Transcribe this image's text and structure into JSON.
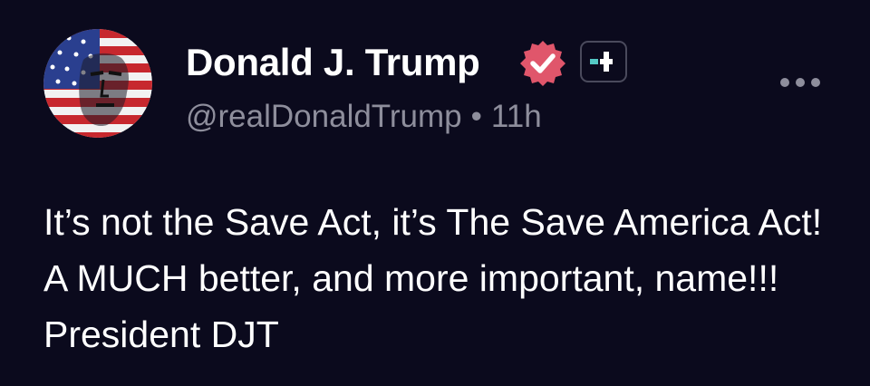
{
  "author": {
    "display_name": "Donald J. Trump",
    "handle": "@realDonaldTrump",
    "separator": "•",
    "timestamp": "11h",
    "verified_badge_icon": "verified-check-icon",
    "verified_badge_color": "#e0566b",
    "subscription_badge_icon": "plus-icon",
    "avatar_icon": "flag-portrait-avatar"
  },
  "post": {
    "text": "It’s not the Save Act, it’s The Save America Act! A MUCH better, and more important, name!!! President DJT"
  },
  "actions": {
    "more_icon": "more-horizontal-icon"
  },
  "colors": {
    "background": "#0b0a1d",
    "primary_text": "#ffffff",
    "secondary_text": "#8e8e9c",
    "accent_teal": "#54c9c5"
  }
}
